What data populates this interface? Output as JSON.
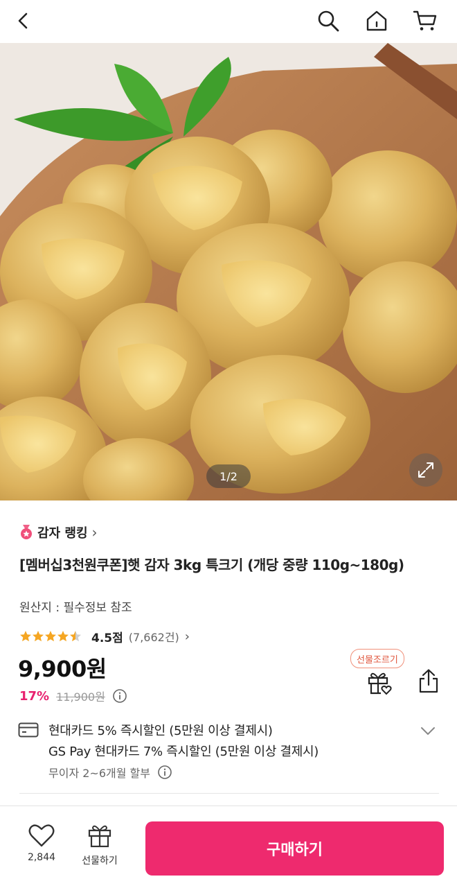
{
  "header": {
    "back_icon": "back-icon",
    "search_icon": "search-icon",
    "home_icon": "home-icon",
    "cart_icon": "cart-icon"
  },
  "gallery": {
    "counter": "1/2"
  },
  "ranking": {
    "label": "감자 랭킹",
    "chevron": "›"
  },
  "product": {
    "title": "[멤버십3천원쿠폰]햇 감자 3kg 특크기 (개당 중량 110g~180g)",
    "origin": "원산지 : 필수정보 참조"
  },
  "rating": {
    "stars": 4.5,
    "score": "4.5점",
    "count": "(7,662건)",
    "chevron": "›"
  },
  "price": {
    "current": "9,900원",
    "discount_rate": "17%",
    "original": "11,900원"
  },
  "gift_request": "선물조르기",
  "benefits": {
    "card1": "현대카드 5% 즉시할인 (5만원 이상 결제시)",
    "card2": "GS Pay 현대카드 7% 즉시할인 (5만원 이상 결제시)",
    "installment": "무이자 2~6개월 할부"
  },
  "bottom_bar": {
    "like_count": "2,844",
    "gift_label": "선물하기",
    "buy_label": "구매하기"
  },
  "colors": {
    "accent": "#ee2a6e",
    "discount": "#e8216f",
    "star": "#f5a623"
  }
}
